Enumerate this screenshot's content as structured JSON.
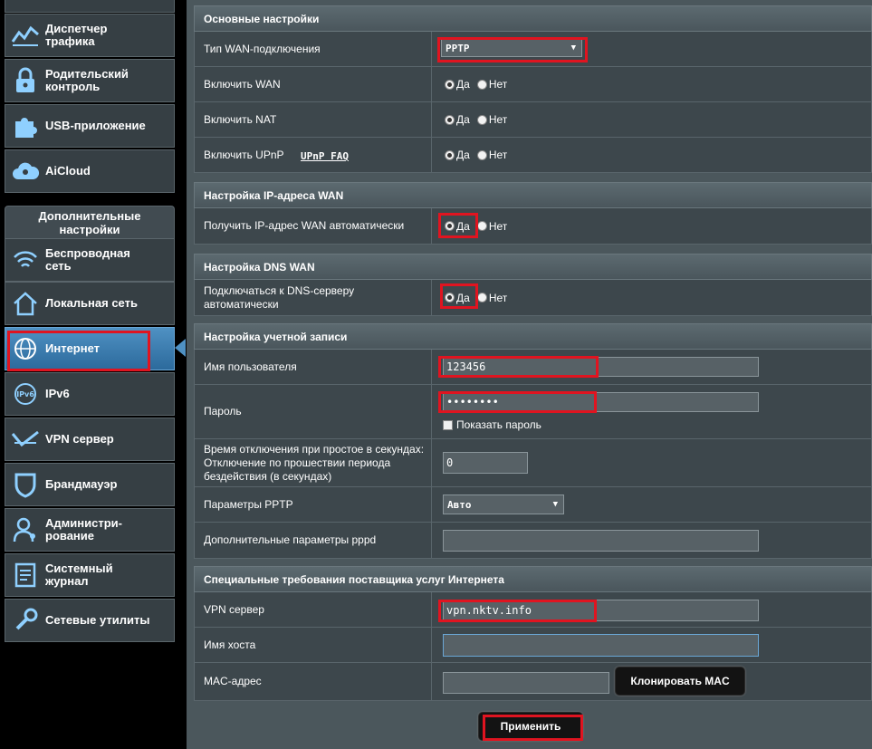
{
  "sidebar": {
    "top_items": [
      {
        "label": "Диспетчер\nтрафика",
        "icon": "traffic-icon"
      },
      {
        "label": "Родительский\nконтроль",
        "icon": "lock-icon"
      },
      {
        "label": "USB-приложение",
        "icon": "puzzle-icon"
      },
      {
        "label": "AiCloud",
        "icon": "cloud-icon"
      }
    ],
    "advanced_header": "Дополнительные\nнастройки",
    "advanced_items": [
      {
        "label": "Беспроводная\nсеть",
        "icon": "wifi-icon"
      },
      {
        "label": "Локальная сеть",
        "icon": "home-icon"
      },
      {
        "label": "Интернет",
        "icon": "globe-icon",
        "active": true
      },
      {
        "label": "IPv6",
        "icon": "ipv6-icon"
      },
      {
        "label": "VPN сервер",
        "icon": "vpn-icon"
      },
      {
        "label": "Брандмауэр",
        "icon": "shield-icon"
      },
      {
        "label": "Администри-\nрование",
        "icon": "admin-icon"
      },
      {
        "label": "Системный\nжурнал",
        "icon": "log-icon"
      },
      {
        "label": "Сетевые утилиты",
        "icon": "tools-icon"
      }
    ]
  },
  "basic": {
    "title": "Основные настройки",
    "wan_type_label": "Тип WAN-подключения",
    "wan_type_value": "PPTP",
    "enable_wan_label": "Включить WAN",
    "enable_nat_label": "Включить NAT",
    "enable_upnp_label": "Включить UPnP",
    "upnp_faq": "UPnP FAQ",
    "yes": "Да",
    "no": "Нет"
  },
  "wan_ip": {
    "title": "Настройка IP-адреса WAN",
    "auto_label": "Получить IP-адрес WAN автоматически"
  },
  "dns": {
    "title": "Настройка DNS WAN",
    "auto_label": "Подключаться к DNS-серверу автоматически"
  },
  "account": {
    "title": "Настройка учетной записи",
    "username_label": "Имя пользователя",
    "username_value": "123456",
    "password_label": "Пароль",
    "password_value": "••••••••",
    "show_password": "Показать пароль",
    "idle_label": "Время отключения при простое в секундах: Отключение по прошествии периода бездействия (в секундах)",
    "idle_value": "0",
    "pptp_label": "Параметры PPTP",
    "pptp_value": "Авто",
    "pppd_label": "Дополнительные параметры pppd",
    "pppd_value": ""
  },
  "isp": {
    "title": "Специальные требования поставщика услуг Интернета",
    "vpn_label": "VPN сервер",
    "vpn_value": "vpn.nktv.info",
    "host_label": "Имя хоста",
    "host_value": "",
    "mac_label": "MAC-адрес",
    "mac_value": "",
    "clone_mac": "Клонировать MAC"
  },
  "apply": "Применить",
  "colors": {
    "highlight": "#e01420",
    "active_nav": "#3a7db3"
  }
}
